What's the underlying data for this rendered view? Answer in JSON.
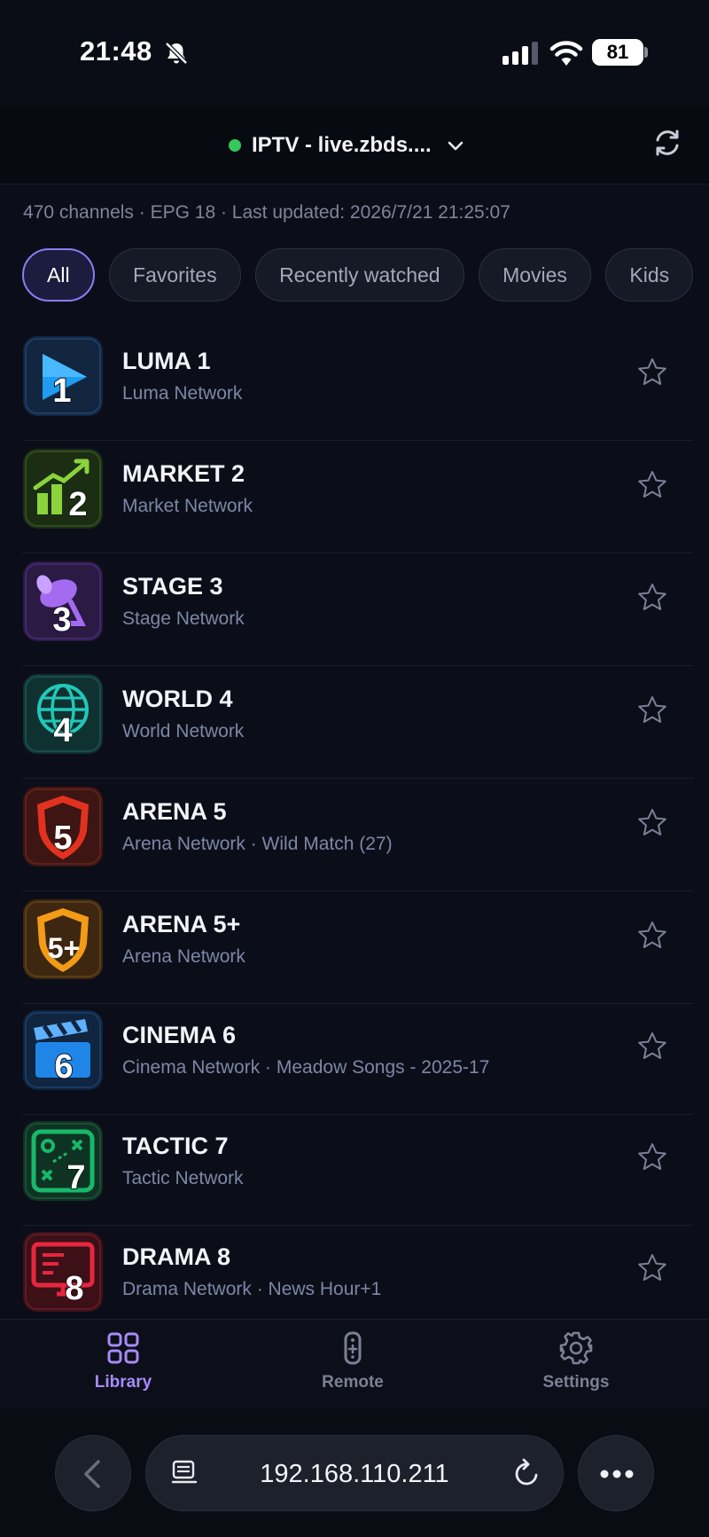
{
  "status_bar": {
    "time": "21:48",
    "battery": "81"
  },
  "header": {
    "source_name": "IPTV - live.zbds...."
  },
  "meta": {
    "summary": "470 channels · EPG 18 · Last updated: 2026/7/21 21:25:07"
  },
  "chips": [
    {
      "label": "All",
      "active": true
    },
    {
      "label": "Favorites"
    },
    {
      "label": "Recently watched"
    },
    {
      "label": "Movies"
    },
    {
      "label": "Kids"
    }
  ],
  "channels": [
    {
      "name": "LUMA 1",
      "subtitle": "Luma Network",
      "logo_number": "1",
      "logo_icon": "play-icon",
      "color": "#1a8fe3"
    },
    {
      "name": "MARKET 2",
      "subtitle": "Market Network",
      "logo_number": "2",
      "logo_icon": "chart-icon",
      "color": "#7cc42a"
    },
    {
      "name": "STAGE 3",
      "subtitle": "Stage Network",
      "logo_number": "3",
      "logo_icon": "spotlight-icon",
      "color": "#9b59e6"
    },
    {
      "name": "WORLD 4",
      "subtitle": "World Network",
      "logo_number": "4",
      "logo_icon": "globe-icon",
      "color": "#1bb5a8"
    },
    {
      "name": "ARENA 5",
      "subtitle": "Arena Network  ·  Wild Match (27)",
      "logo_number": "5",
      "logo_icon": "shield-icon",
      "color": "#e2321f"
    },
    {
      "name": "ARENA 5+",
      "subtitle": "Arena Network",
      "logo_number": "5+",
      "logo_icon": "shield-icon",
      "color": "#f39a16"
    },
    {
      "name": "CINEMA 6",
      "subtitle": "Cinema Network  ·  Meadow Songs - 2025-17",
      "logo_number": "6",
      "logo_icon": "clapper-icon",
      "color": "#1f86e8"
    },
    {
      "name": "TACTIC 7",
      "subtitle": "Tactic Network",
      "logo_number": "7",
      "logo_icon": "tactics-board-icon",
      "color": "#18b86a"
    },
    {
      "name": "DRAMA 8",
      "subtitle": "Drama Network  ·  News Hour+1",
      "logo_number": "8",
      "logo_icon": "monitor-icon",
      "color": "#e8263f"
    }
  ],
  "nav": {
    "library": "Library",
    "remote": "Remote",
    "settings": "Settings"
  },
  "browser": {
    "url": "192.168.110.211"
  },
  "colors": {
    "accent": "#8b7cf6",
    "background": "#0b0e18",
    "online": "#34c759"
  }
}
